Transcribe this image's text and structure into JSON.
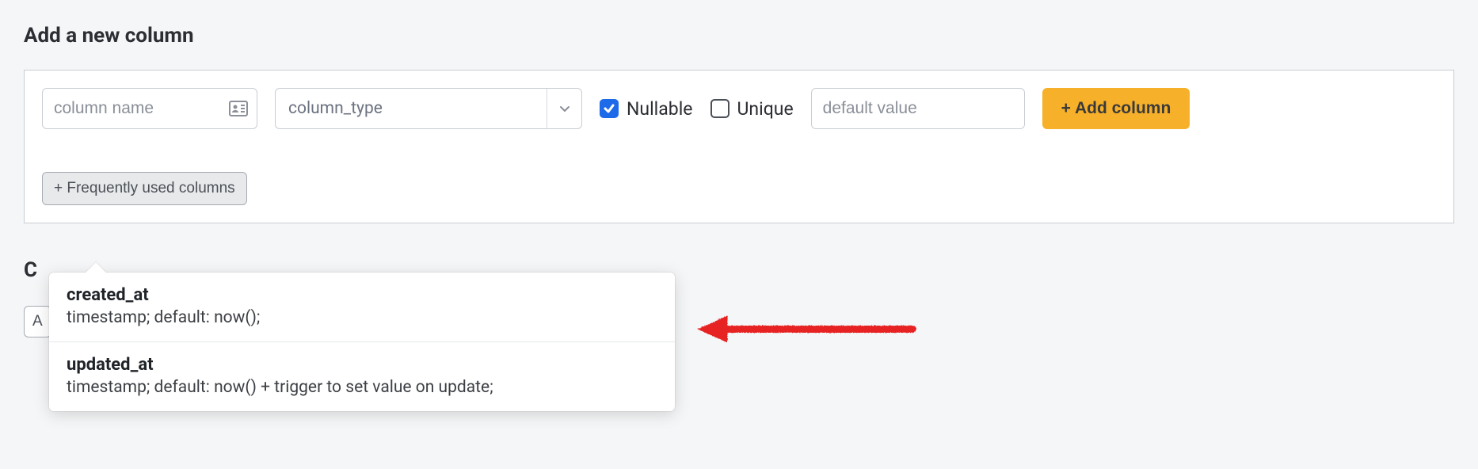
{
  "section": {
    "title": "Add a new column"
  },
  "form": {
    "column_name": {
      "placeholder": "column name",
      "value": ""
    },
    "column_type": {
      "placeholder": "column_type"
    },
    "nullable": {
      "label": "Nullable",
      "checked": true
    },
    "unique": {
      "label": "Unique",
      "checked": false
    },
    "default_value": {
      "placeholder": "default value",
      "value": ""
    },
    "add_button": "+ Add column",
    "frequently_used_button": "+ Frequently used columns"
  },
  "under": {
    "partial_title": "C",
    "partial_button": "A"
  },
  "popover": {
    "items": [
      {
        "title": "created_at",
        "desc": "timestamp; default: now();"
      },
      {
        "title": "updated_at",
        "desc": "timestamp; default: now() + trigger to set value on update;"
      }
    ]
  }
}
